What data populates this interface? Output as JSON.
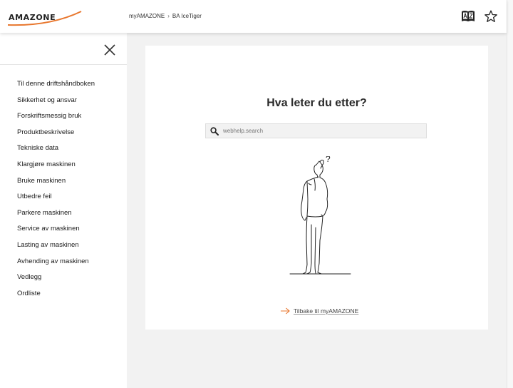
{
  "header": {
    "logo_text": "AMAZONE",
    "breadcrumb": [
      "myAMAZONE",
      "BA IceTiger"
    ],
    "breadcrumb_separator": "›",
    "icons": [
      "dictionary-icon",
      "star-icon"
    ]
  },
  "sidebar": {
    "close_icon": "close-icon",
    "items": [
      "Til denne driftshåndboken",
      "Sikkerhet og ansvar",
      "Forskriftsmessig bruk",
      "Produktbeskrivelse",
      "Tekniske data",
      "Klargjøre maskinen",
      "Bruke maskinen",
      "Utbedre feil",
      "Parkere maskinen",
      "Service av maskinen",
      "Lasting av maskinen",
      "Avhending av maskinen",
      "Vedlegg",
      "Ordliste"
    ]
  },
  "main": {
    "heading": "Hva leter du etter?",
    "search": {
      "placeholder": "webhelp.search",
      "value": ""
    },
    "back_link": "Tilbake til myAMAZONE"
  },
  "colors": {
    "accent": "#e8772e",
    "text": "#1a1a1a",
    "background": "#f2f2f2",
    "card": "#ffffff"
  }
}
